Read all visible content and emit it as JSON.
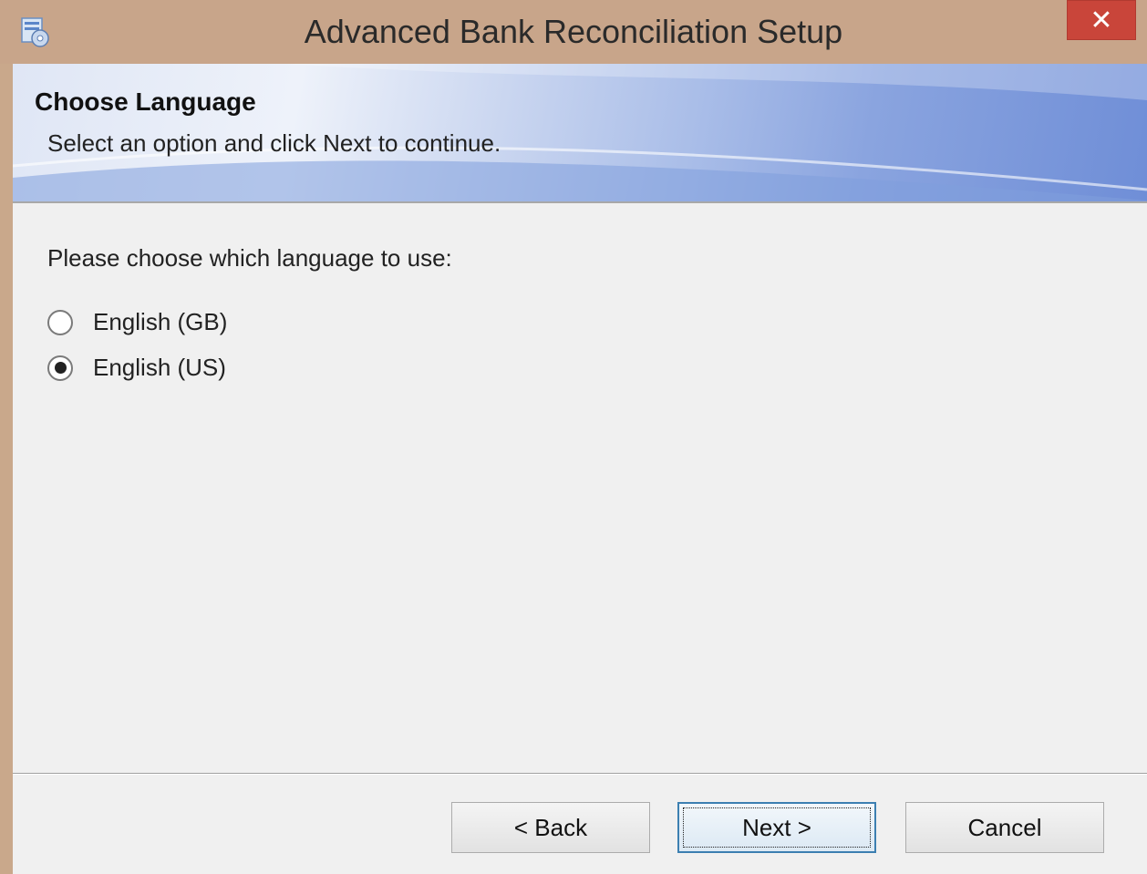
{
  "window": {
    "title": "Advanced Bank Reconciliation Setup",
    "icon": "setup-installer-icon",
    "close_glyph": "✕"
  },
  "header": {
    "title": "Choose Language",
    "subtitle": "Select an option and click Next to continue."
  },
  "main": {
    "prompt": "Please choose which language to use:",
    "options": [
      {
        "label": "English (GB)",
        "selected": false
      },
      {
        "label": "English (US)",
        "selected": true
      }
    ]
  },
  "buttons": {
    "back": "< Back",
    "next": "Next >",
    "cancel": "Cancel"
  }
}
